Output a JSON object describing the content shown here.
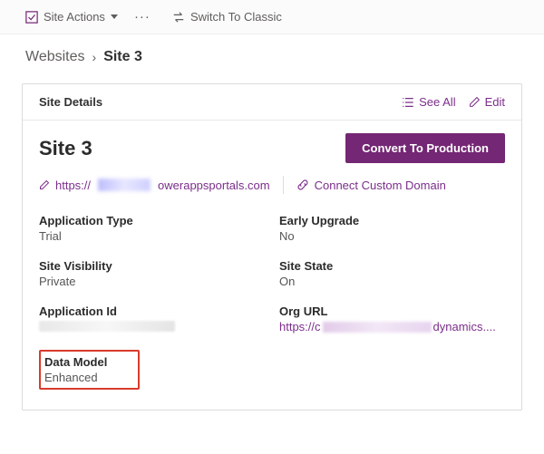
{
  "topbar": {
    "siteActions": "Site Actions",
    "switchClassic": "Switch To Classic"
  },
  "breadcrumb": {
    "parent": "Websites",
    "current": "Site 3"
  },
  "card": {
    "title": "Site Details",
    "seeAll": "See All",
    "edit": "Edit"
  },
  "site": {
    "name": "Site 3",
    "convertBtn": "Convert To Production",
    "urlPrefix": "https://",
    "urlSuffix": "owerappsportals.com",
    "connectDomain": "Connect Custom Domain"
  },
  "fields": {
    "appType": {
      "label": "Application Type",
      "value": "Trial"
    },
    "earlyUpgrade": {
      "label": "Early Upgrade",
      "value": "No"
    },
    "siteVisibility": {
      "label": "Site Visibility",
      "value": "Private"
    },
    "siteState": {
      "label": "Site State",
      "value": "On"
    },
    "appId": {
      "label": "Application Id"
    },
    "orgUrl": {
      "label": "Org URL",
      "prefix": "https://c",
      "suffix": "dynamics...."
    },
    "dataModel": {
      "label": "Data Model",
      "value": "Enhanced"
    }
  }
}
